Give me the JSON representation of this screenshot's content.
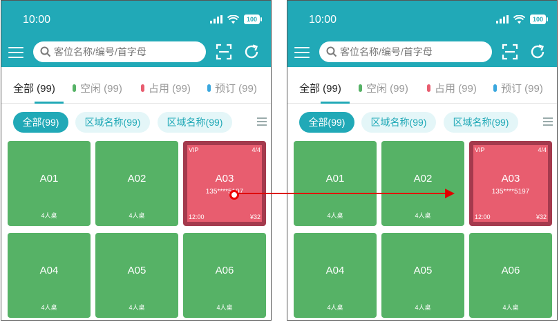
{
  "status": {
    "time": "10:00",
    "battery": "100"
  },
  "search": {
    "placeholder": "客位名称/编号/首字母"
  },
  "tabs": [
    {
      "label": "全部 (99)",
      "color": ""
    },
    {
      "label": "空闲 (99)",
      "color": "#56b266"
    },
    {
      "label": "占用 (99)",
      "color": "#e85d6f"
    },
    {
      "label": "预订 (99)",
      "color": "#3aa7de"
    }
  ],
  "filters": [
    "全部(99)",
    "区域名称(99)",
    "区域名称(99)"
  ],
  "tables": [
    {
      "name": "A01",
      "capacity": "4人桌",
      "status": "free"
    },
    {
      "name": "A02",
      "capacity": "4人桌",
      "status": "free"
    },
    {
      "name": "A03",
      "capacity": "4人桌",
      "status": "occupied",
      "vip": "VIP",
      "count": "4/4",
      "phone": "135****5197",
      "time": "12:00",
      "price": "¥32"
    },
    {
      "name": "A04",
      "capacity": "4人桌",
      "status": "free"
    },
    {
      "name": "A05",
      "capacity": "4人桌",
      "status": "free"
    },
    {
      "name": "A06",
      "capacity": "4人桌",
      "status": "free"
    }
  ],
  "colors": {
    "brand": "#21a9b7",
    "free": "#56b266",
    "occupied": "#e85d6f",
    "occupied_border": "#a43a4d",
    "arrow": "#e00000"
  }
}
